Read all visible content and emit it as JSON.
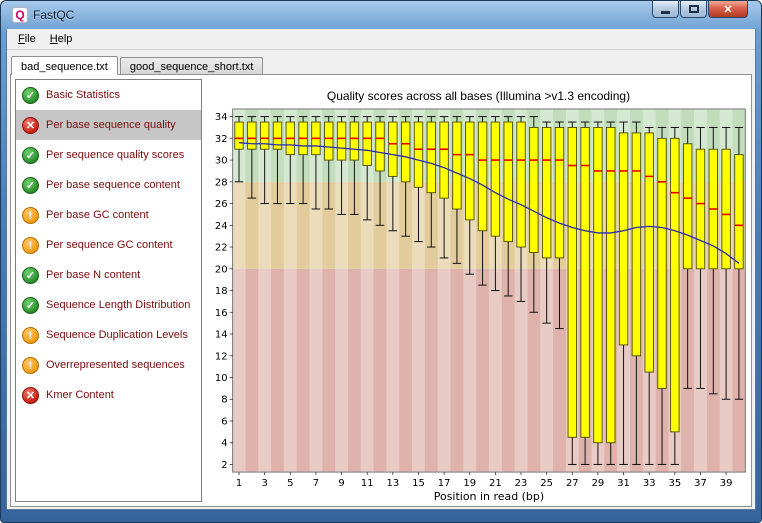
{
  "window": {
    "title": "FastQC",
    "controls": {
      "close_glyph": "✕"
    }
  },
  "menu": {
    "items": [
      {
        "label": "File"
      },
      {
        "label": "Help"
      }
    ]
  },
  "tabs": [
    {
      "label": "bad_sequence.txt",
      "active": true
    },
    {
      "label": "good_sequence_short.txt",
      "active": false
    }
  ],
  "icons": {
    "pass": "✓",
    "fail": "✕",
    "warn": "!"
  },
  "sidebar": {
    "items": [
      {
        "label": "Basic Statistics",
        "status": "pass",
        "selected": false
      },
      {
        "label": "Per base sequence quality",
        "status": "fail",
        "selected": true
      },
      {
        "label": "Per sequence quality scores",
        "status": "pass",
        "selected": false
      },
      {
        "label": "Per base sequence content",
        "status": "pass",
        "selected": false
      },
      {
        "label": "Per base GC content",
        "status": "warn",
        "selected": false
      },
      {
        "label": "Per sequence GC content",
        "status": "warn",
        "selected": false
      },
      {
        "label": "Per base N content",
        "status": "pass",
        "selected": false
      },
      {
        "label": "Sequence Length Distribution",
        "status": "pass",
        "selected": false
      },
      {
        "label": "Sequence Duplication Levels",
        "status": "warn",
        "selected": false
      },
      {
        "label": "Overrepresented sequences",
        "status": "warn",
        "selected": false
      },
      {
        "label": "Kmer Content",
        "status": "fail",
        "selected": false
      }
    ]
  },
  "chart_data": {
    "type": "boxplot",
    "title": "Quality scores across all bases (Illumina >v1.3 encoding)",
    "xlabel": "Position in read (bp)",
    "ylim": [
      2,
      34
    ],
    "y_ticks": [
      2,
      4,
      6,
      8,
      10,
      12,
      14,
      16,
      18,
      20,
      22,
      24,
      26,
      28,
      30,
      32,
      34
    ],
    "x": [
      1,
      2,
      3,
      4,
      5,
      6,
      7,
      8,
      9,
      10,
      11,
      12,
      13,
      14,
      15,
      16,
      17,
      18,
      19,
      20,
      21,
      22,
      23,
      24,
      25,
      26,
      27,
      28,
      29,
      30,
      31,
      32,
      33,
      34,
      35,
      36,
      37,
      38,
      39,
      40
    ],
    "x_tick_labels": [
      1,
      3,
      5,
      7,
      9,
      11,
      13,
      15,
      17,
      19,
      21,
      23,
      25,
      27,
      29,
      31,
      33,
      35,
      37,
      39
    ],
    "zones": [
      {
        "name": "good",
        "lo": 28,
        "hi": 34,
        "color": "#c2ddbb"
      },
      {
        "name": "medium",
        "lo": 20,
        "hi": 28,
        "color": "#e2cc9b"
      },
      {
        "name": "poor",
        "lo": 2,
        "hi": 20,
        "color": "#dfb3ac"
      }
    ],
    "series": {
      "mean": [
        31.6,
        31.5,
        31.5,
        31.4,
        31.4,
        31.3,
        31.3,
        31.2,
        31.1,
        31.0,
        30.9,
        30.7,
        30.5,
        30.3,
        30.0,
        29.7,
        29.3,
        28.8,
        28.3,
        27.7,
        27.0,
        26.4,
        25.9,
        25.3,
        24.7,
        24.2,
        23.8,
        23.5,
        23.3,
        23.3,
        23.5,
        23.8,
        23.9,
        23.8,
        23.5,
        23.1,
        22.6,
        22.1,
        21.4,
        20.5
      ],
      "median": [
        32,
        32,
        32,
        32,
        32,
        32,
        32,
        32,
        32,
        32,
        32,
        32,
        31.5,
        31.5,
        31,
        31,
        31,
        30.5,
        30.5,
        30,
        30,
        30,
        30,
        30,
        30,
        30,
        29.5,
        29.5,
        29,
        29,
        29,
        29,
        28.5,
        28,
        27,
        26.5,
        26,
        25.5,
        25,
        24
      ],
      "lower_quartile": [
        31,
        31,
        31,
        31,
        30.5,
        30.5,
        30.5,
        30,
        30,
        30,
        29.5,
        29,
        28.5,
        28,
        27.5,
        27,
        26.5,
        25.5,
        24.5,
        23.5,
        23,
        22.5,
        22,
        21.5,
        21,
        21,
        4.5,
        4.5,
        4,
        4,
        13,
        12,
        10.5,
        9,
        5,
        20,
        20,
        20,
        20,
        20
      ],
      "upper_quartile": [
        33.5,
        33.5,
        33.5,
        33.5,
        33.5,
        33.5,
        33.5,
        33.5,
        33.5,
        33.5,
        33.5,
        33.5,
        33.5,
        33.5,
        33.5,
        33.5,
        33.5,
        33.5,
        33.5,
        33.5,
        33.5,
        33.5,
        33.5,
        33,
        33,
        33,
        33,
        33,
        33,
        33,
        32.5,
        32.5,
        32.5,
        32,
        32,
        31.5,
        31,
        31,
        31,
        30.5
      ],
      "percentile_10": [
        28,
        26.5,
        26,
        26,
        26,
        26,
        25.5,
        25.5,
        25,
        25,
        24.5,
        24,
        23.5,
        23,
        22.5,
        22,
        21,
        20.5,
        19.5,
        18.5,
        18,
        17.5,
        17,
        16,
        15,
        14.5,
        2,
        2,
        2,
        2,
        2,
        2,
        2,
        2,
        2,
        9,
        9,
        8.5,
        8,
        8
      ],
      "percentile_90": [
        34,
        34,
        34,
        34,
        34,
        34,
        34,
        34,
        34,
        34,
        34,
        34,
        34,
        34,
        34,
        34,
        34,
        34,
        34,
        34,
        34,
        34,
        34,
        34,
        33.5,
        33.5,
        33.5,
        33.5,
        33.5,
        33.5,
        33.5,
        33.5,
        33,
        33,
        33,
        33,
        33,
        33,
        33,
        33
      ]
    },
    "colors": {
      "box": "#ffff00",
      "box_border": "#4d4d00",
      "median": "#e80000",
      "mean": "#2b2bb2",
      "whisker": "#111111",
      "stripe_overlay": "#ffffff"
    }
  }
}
